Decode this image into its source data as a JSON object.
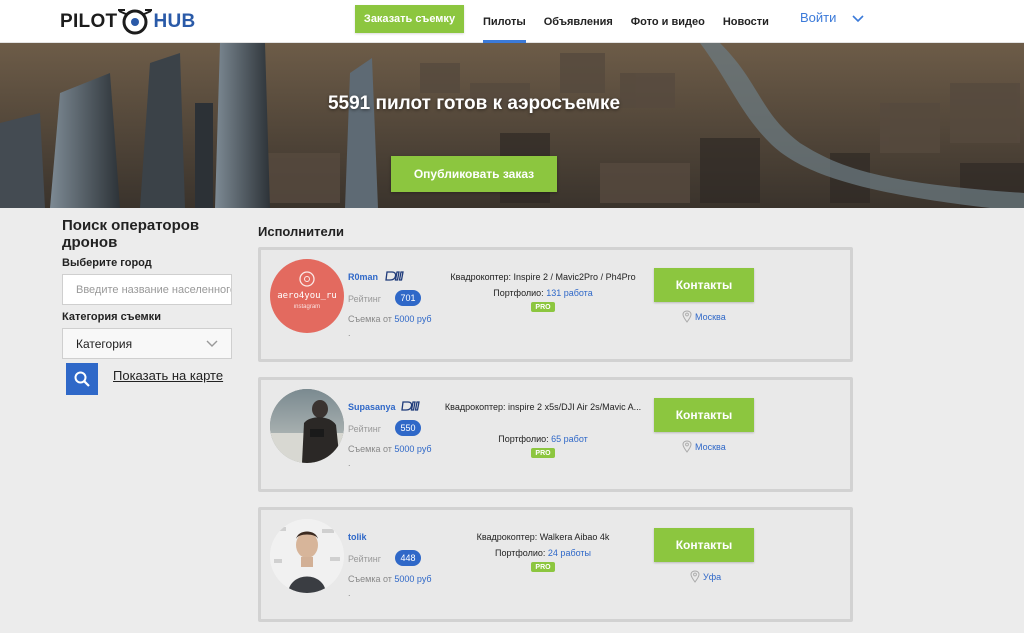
{
  "header": {
    "logo_left": "PILOT",
    "logo_right": "HUB",
    "order_button": "Заказать съемку",
    "nav": [
      "Пилоты",
      "Объявления",
      "Фото и видео",
      "Новости"
    ],
    "active_nav": "Пилоты",
    "login": "Войти"
  },
  "hero": {
    "title": "5591 пилот готов к аэросъемке",
    "publish_button": "Опубликовать заказ"
  },
  "sidebar": {
    "title": "Поиск операторов дронов",
    "city_label": "Выберите город",
    "city_placeholder": "Введите название населенного пункта",
    "category_label": "Категория съемки",
    "category_value": "Категория",
    "map_link": "Показать на карте"
  },
  "list": {
    "title": "Исполнители",
    "rating_label": "Рейтинг",
    "price_label": "Съемка от",
    "portfolio_label": "Портфолио:",
    "pro_label": "PRO",
    "contacts_button": "Контакты",
    "dot": ".",
    "cards": [
      {
        "name": "R0man",
        "avatar_text": "aero4you_ru",
        "avatar_sub": "instagram",
        "rating": "701",
        "price": "5000 руб",
        "drone": "Квадрокоптер: Inspire 2 / Mavic2Pro / Ph4Pro",
        "portfolio": "131 работа",
        "city": "Москва"
      },
      {
        "name": "Supasanya",
        "rating": "550",
        "price": "5000 руб",
        "drone": "Квадрокоптер: inspire 2 x5s/DJI Air 2s/Mavic A...",
        "portfolio": "65 работ",
        "city": "Москва"
      },
      {
        "name": "tolik",
        "rating": "448",
        "price": "5000 руб",
        "drone": "Квадрокоптер: Walkera Aibao 4k",
        "portfolio": "24 работы",
        "city": "Уфа"
      }
    ]
  },
  "colors": {
    "accent_green": "#8cc63f",
    "accent_blue": "#2f68c8",
    "card_bg": "#e9e9e9"
  }
}
